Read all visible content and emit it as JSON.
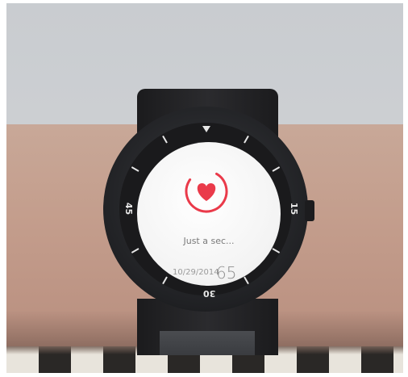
{
  "screen": {
    "status_text": "Just a sec...",
    "date": "10/29/2014",
    "number": "65"
  },
  "bezel": {
    "top_marker_icon": "triangle-marker-icon",
    "label_left": "45",
    "label_right": "15",
    "label_bottom": "30"
  },
  "colors": {
    "heart": "#ea3a4a",
    "screen_bg": "#f4f4f4",
    "watch_body": "#1e1f22"
  }
}
